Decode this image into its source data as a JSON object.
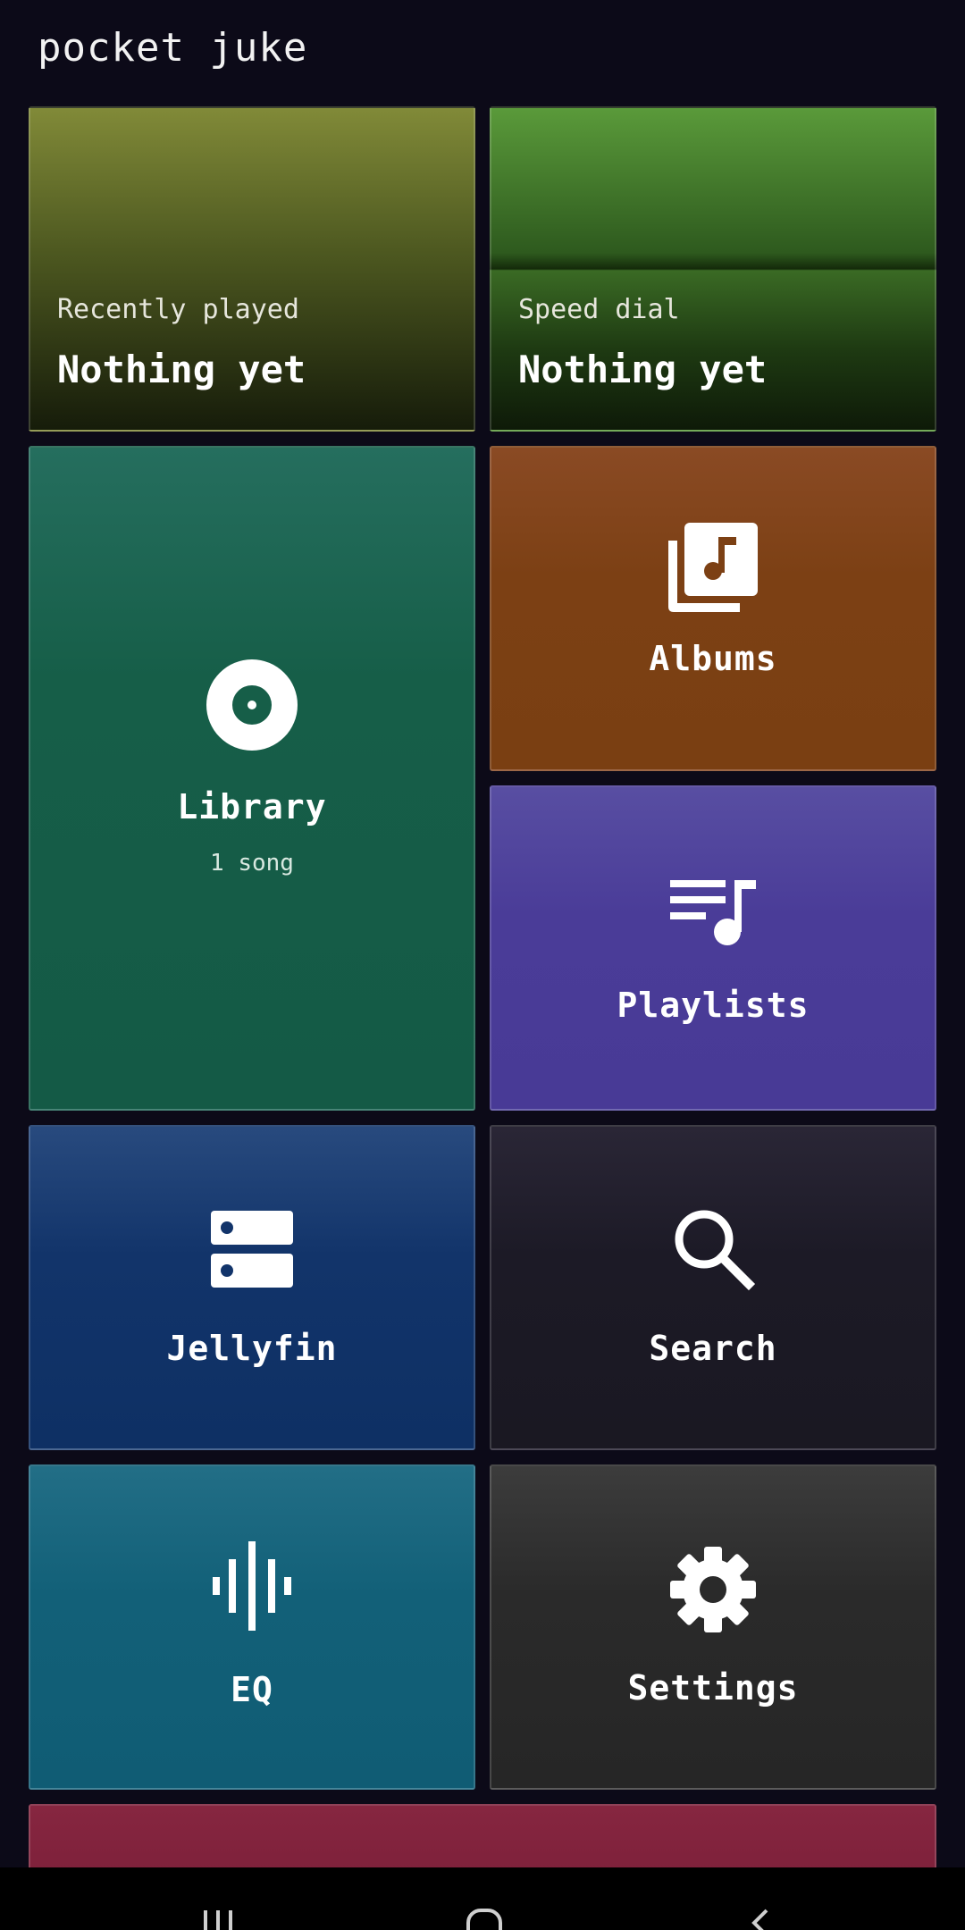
{
  "app": {
    "title": "pocket juke"
  },
  "tiles": {
    "recently_played": {
      "caption": "Recently played",
      "value": "Nothing yet"
    },
    "speed_dial": {
      "caption": "Speed dial",
      "value": "Nothing yet"
    },
    "library": {
      "label": "Library",
      "subtitle": "1 song",
      "icon": "disc-icon"
    },
    "albums": {
      "label": "Albums",
      "icon": "album-icon"
    },
    "playlists": {
      "label": "Playlists",
      "icon": "playlist-icon"
    },
    "jellyfin": {
      "label": "Jellyfin",
      "icon": "server-icon"
    },
    "search": {
      "label": "Search",
      "icon": "search-icon"
    },
    "eq": {
      "label": "EQ",
      "icon": "waveform-icon"
    },
    "settings": {
      "label": "Settings",
      "icon": "gear-icon"
    }
  },
  "navbar": {
    "buttons": [
      "recents-icon",
      "home-icon",
      "back-icon"
    ]
  },
  "colors": {
    "background": "#0c0a18",
    "recently_played": "#818a38",
    "speed_dial": "#5a9a3a",
    "library": "#165e48",
    "albums": "#7c4014",
    "playlists": "#4a3c98",
    "jellyfin": "#12346a",
    "search": "#1c1a26",
    "eq": "#126078",
    "settings": "#2a2a2a",
    "partial_tile": "#7a1e38"
  }
}
